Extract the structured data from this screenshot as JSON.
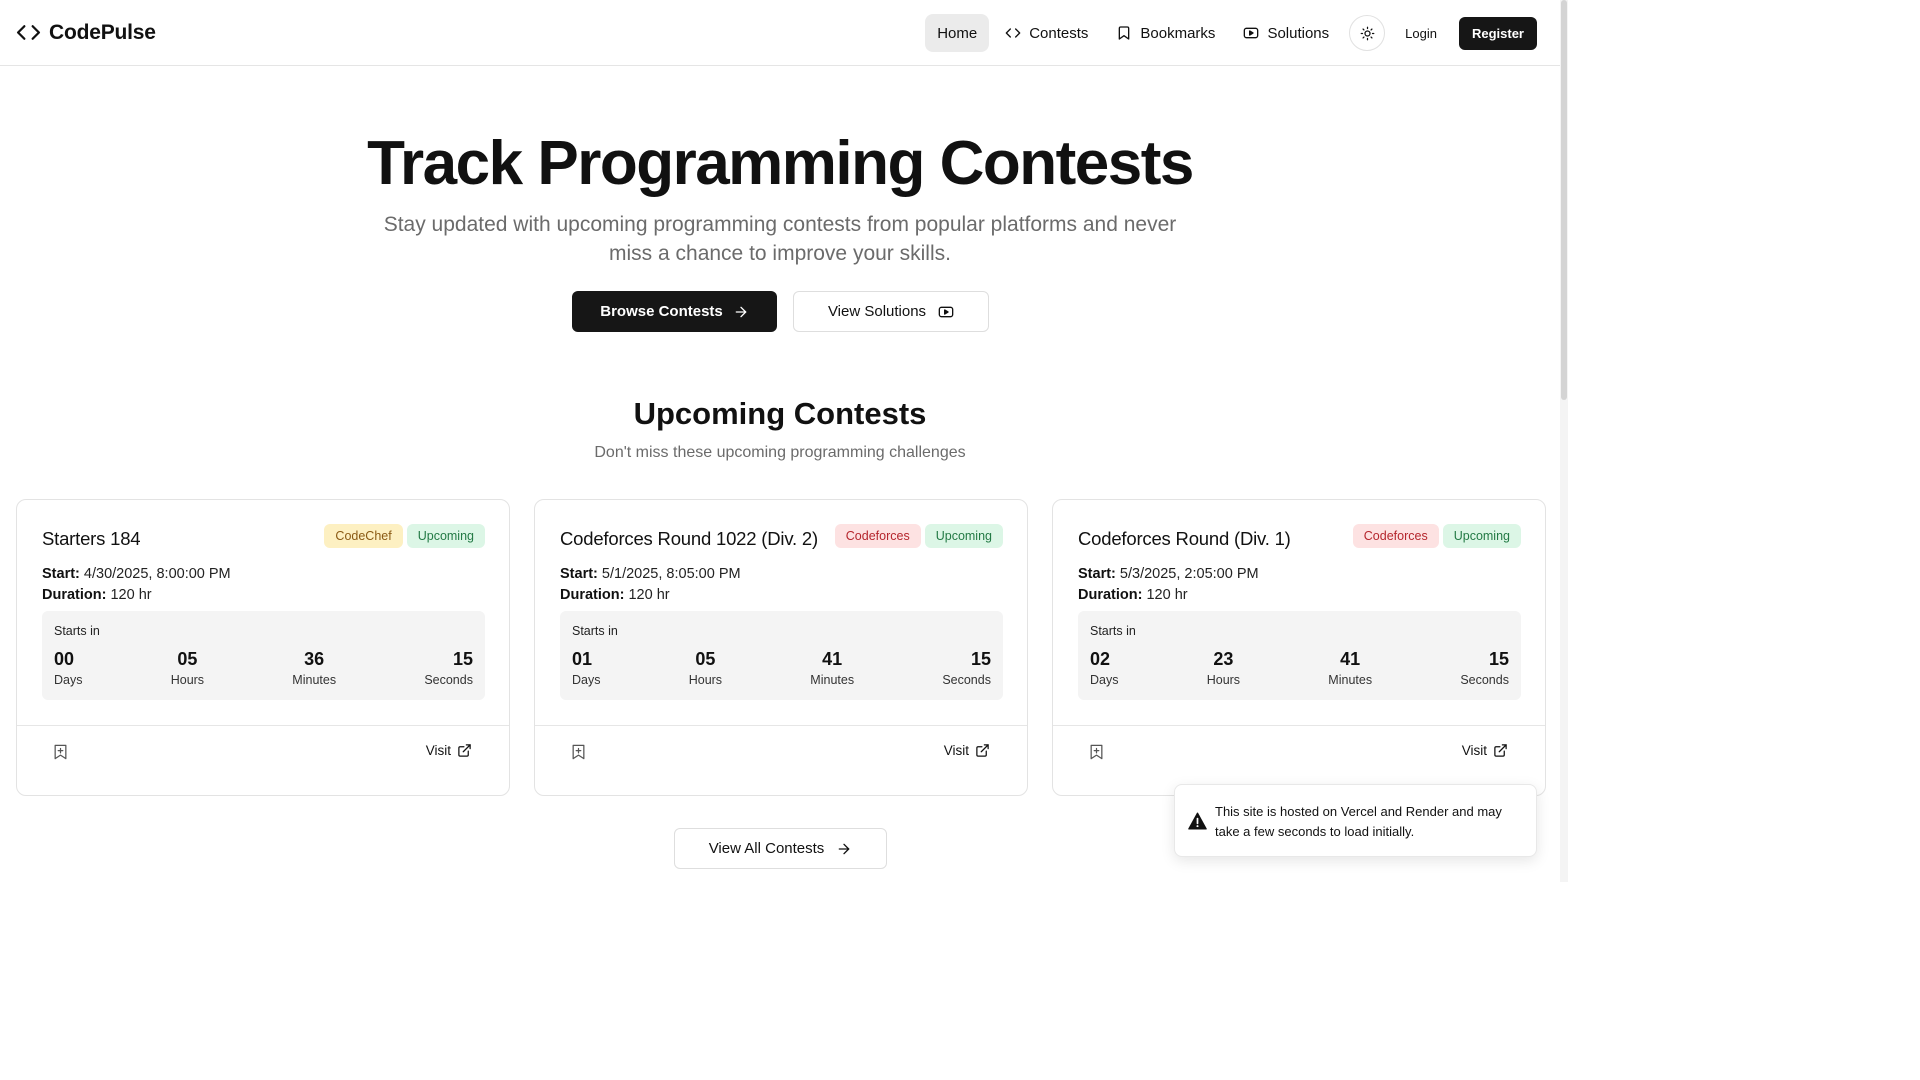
{
  "app": {
    "name": "CodePulse"
  },
  "nav": {
    "items": [
      {
        "label": "Home",
        "icon": "",
        "active": true
      },
      {
        "label": "Contests",
        "icon": "code-icon",
        "active": false
      },
      {
        "label": "Bookmarks",
        "icon": "bookmark-icon",
        "active": false
      },
      {
        "label": "Solutions",
        "icon": "video-icon",
        "active": false
      }
    ],
    "theme_icon": "sun-icon",
    "login": "Login",
    "register": "Register"
  },
  "hero": {
    "title": "Track Programming Contests",
    "subtitle": "Stay updated with upcoming programming contests from popular platforms and never miss a chance to improve your skills.",
    "browse_label": "Browse Contests",
    "solutions_label": "View Solutions"
  },
  "section": {
    "title": "Upcoming Contests",
    "subtitle": "Don't miss these upcoming programming challenges"
  },
  "labels": {
    "start": "Start:",
    "duration": "Duration:",
    "starts_in": "Starts in",
    "days": "Days",
    "hours": "Hours",
    "minutes": "Minutes",
    "seconds": "Seconds",
    "visit": "Visit"
  },
  "contests": [
    {
      "title": "Starters 184",
      "platform": "CodeChef",
      "status": "Upcoming",
      "start": "4/30/2025, 8:00:00 PM",
      "duration": "120 hr",
      "countdown": {
        "days": "00",
        "hours": "05",
        "minutes": "36",
        "seconds": "15"
      }
    },
    {
      "title": "Codeforces Round 1022 (Div. 2)",
      "platform": "Codeforces",
      "status": "Upcoming",
      "start": "5/1/2025, 8:05:00 PM",
      "duration": "120 hr",
      "countdown": {
        "days": "01",
        "hours": "05",
        "minutes": "41",
        "seconds": "15"
      }
    },
    {
      "title": "Codeforces Round (Div. 1)",
      "platform": "Codeforces",
      "status": "Upcoming",
      "start": "5/3/2025, 2:05:00 PM",
      "duration": "120 hr",
      "countdown": {
        "days": "02",
        "hours": "23",
        "minutes": "41",
        "seconds": "15"
      }
    }
  ],
  "view_all_label": "View All Contests",
  "toast": {
    "message": "This site is hosted on Vercel and Render and may take a few seconds to load initially.",
    "icon": "warning-icon"
  },
  "colors": {
    "primary": "#161616",
    "codechef_badge": "#fdf0c2",
    "codeforces_badge": "#fde2e2",
    "upcoming_badge": "#dcf6e6"
  }
}
